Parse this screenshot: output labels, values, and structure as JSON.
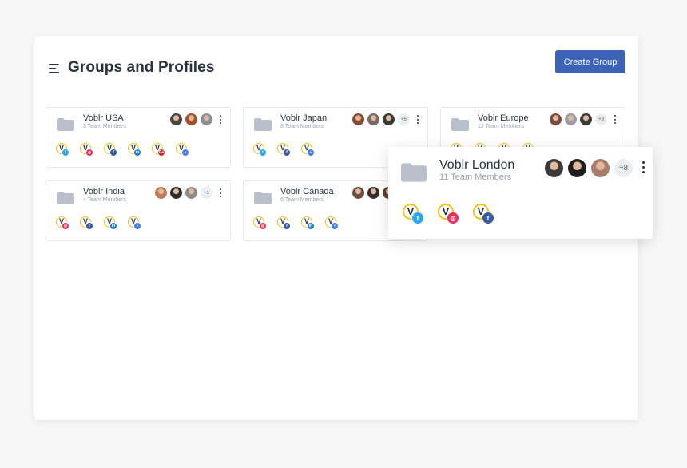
{
  "header": {
    "title": "Groups and Profiles",
    "create_button_label": "Create Group"
  },
  "groups": [
    {
      "name": "Voblr USA",
      "members": "3 Team Members",
      "avatars": [
        "#4b4540",
        "#a0522d",
        "#8b8f96"
      ],
      "more": "",
      "networks": [
        "twitter",
        "instagram",
        "facebook",
        "linkedin",
        "google-plus",
        "google-my-business"
      ]
    },
    {
      "name": "Voblr Japan",
      "members": "8 Team Members",
      "avatars": [
        "#8a4b35",
        "#7a6a66",
        "#3a3a3a"
      ],
      "more": "+5",
      "networks": [
        "twitter",
        "facebook",
        "google-my-business"
      ]
    },
    {
      "name": "Voblr Europe",
      "members": "12 Team Members",
      "avatars": [
        "#7a4a3a",
        "#9a9ea6",
        "#3a3a3a"
      ],
      "more": "+9",
      "networks": [
        "twitter",
        "instagram",
        "facebook",
        "linkedin"
      ]
    },
    {
      "name": "Voblr India",
      "members": "4 Team Members",
      "avatars": [
        "#c07a58",
        "#2e2e2e",
        "#8c8c8c"
      ],
      "more": "+1",
      "networks": [
        "instagram",
        "facebook",
        "linkedin",
        "google-my-business"
      ]
    },
    {
      "name": "Voblr Canada",
      "members": "6 Team Members",
      "avatars": [
        "#6a5040",
        "#3a2e2a",
        "#5a4030"
      ],
      "more": "",
      "networks": [
        "instagram",
        "facebook",
        "linkedin",
        "google-my-business"
      ]
    }
  ],
  "highlighted_group": {
    "name": "Voblr London",
    "members": "11 Team Members",
    "avatars": [
      "#3a3a3a",
      "#1e1e1e",
      "#a87d6a"
    ],
    "more": "+8",
    "networks": [
      "twitter",
      "instagram",
      "facebook"
    ]
  },
  "network_styles": {
    "twitter": {
      "color": "#2ea7e6",
      "glyph": "t"
    },
    "instagram": {
      "color": "#e8305f",
      "glyph": "◎"
    },
    "facebook": {
      "color": "#3b5b9c",
      "glyph": "f"
    },
    "linkedin": {
      "color": "#1e84c4",
      "glyph": "in"
    },
    "google-plus": {
      "color": "#d62c2c",
      "glyph": "G+"
    },
    "google-my-business": {
      "color": "#4a7ff0",
      "glyph": "▪"
    }
  },
  "logo_letter": "V"
}
